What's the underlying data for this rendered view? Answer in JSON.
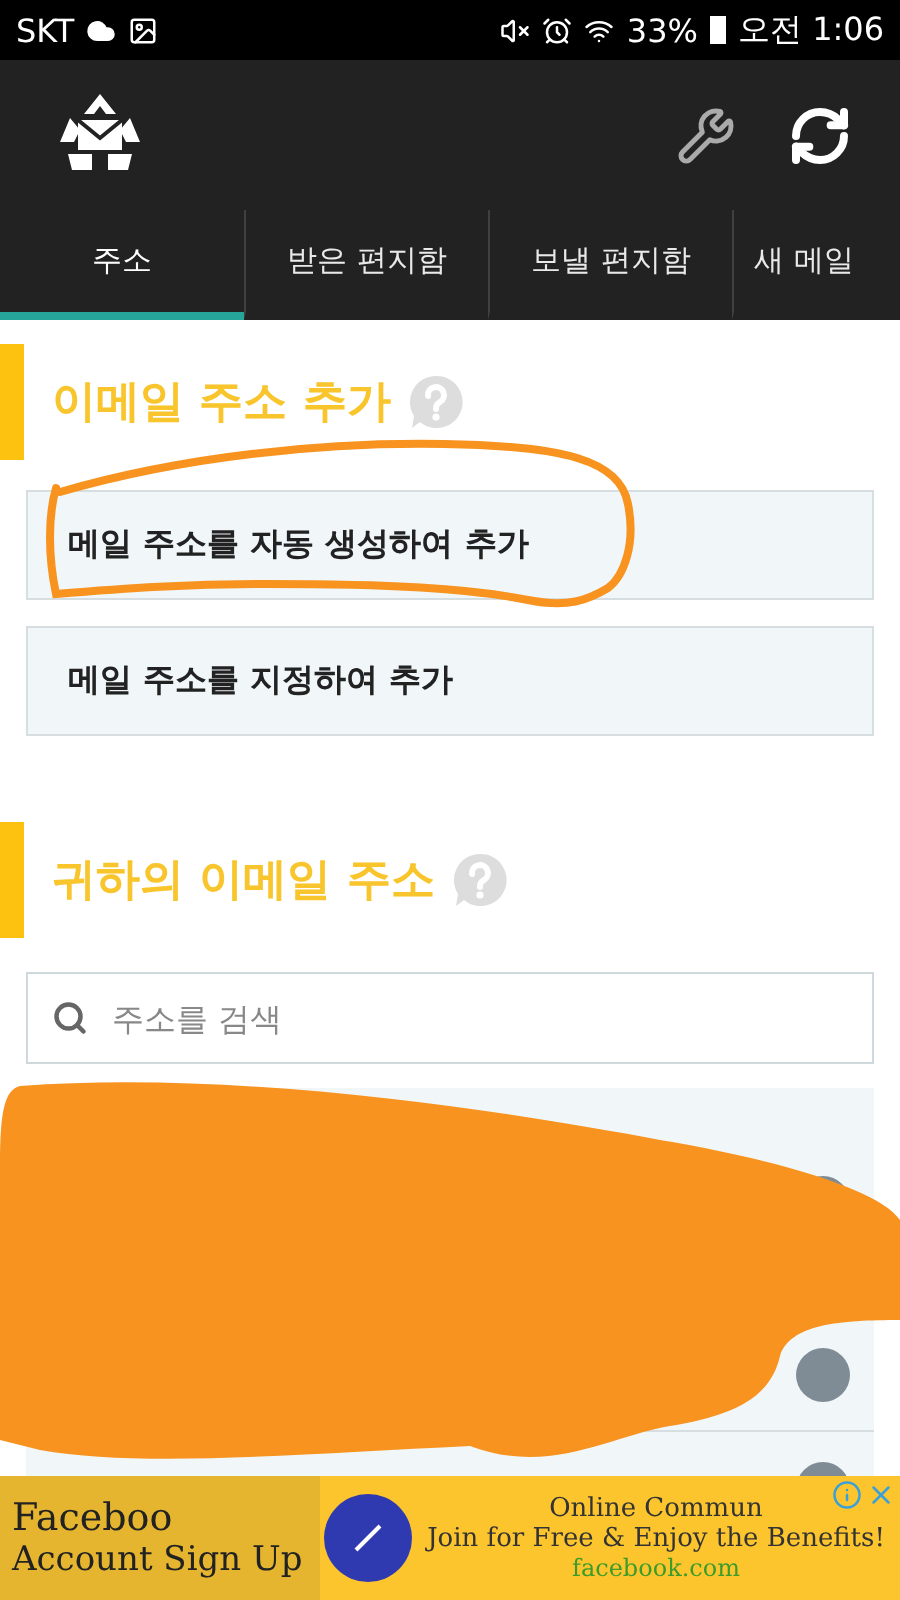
{
  "status_bar": {
    "carrier": "SKT",
    "battery": "33%",
    "time": "오전 1:06"
  },
  "tabs": [
    {
      "label": "주소",
      "selected": true
    },
    {
      "label": "받은 편지함",
      "selected": false
    },
    {
      "label": "보낼 편지함",
      "selected": false
    },
    {
      "label": "새 메일",
      "selected": false
    }
  ],
  "add_section": {
    "title": "이메일 주소 추가",
    "buttons": [
      "메일 주소를 자동 생성하여 추가",
      "메일 주소를 지정하여 추가"
    ]
  },
  "address_section": {
    "title": "귀하의 이메일 주소",
    "search": {
      "placeholder": "주소를 검색"
    }
  },
  "ad": {
    "left_lines": [
      "Faceboo",
      "Account Sign Up"
    ],
    "headline": "Online Commun",
    "tagline": "Join for Free & Enjoy the Benefits!",
    "domain": "facebook.com"
  }
}
